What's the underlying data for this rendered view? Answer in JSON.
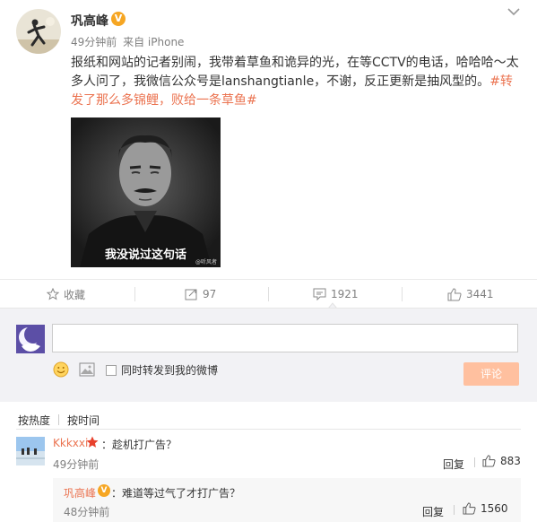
{
  "post": {
    "author": "巩高峰",
    "verified_mark": "V",
    "time": "49分钟前",
    "source": "来自 iPhone",
    "text": "报纸和网站的记者别闹，我带着草鱼和诡异的光，在等CCTV的电话，哈哈哈～太多人问了，我微信公众号是lanshangtianle，不谢，反正更新是抽风型的。",
    "topic": "#转发了那么多锦鲤，败给一条草鱼#",
    "image_caption": "我没说过这句话",
    "image_watermark": "@听风者",
    "accent_color": "#eb7350"
  },
  "actions": {
    "favorite_label": "收藏",
    "repost_count": "97",
    "comment_count": "1921",
    "like_count": "3441"
  },
  "composer": {
    "input_value": "",
    "checkbox_label": "同时转发到我的微博",
    "submit_label": "评论",
    "submit_color": "#ffc09f"
  },
  "sort": {
    "hot_label": "按热度",
    "time_label": "按时间"
  },
  "comments": [
    {
      "name": "Kkkxxi",
      "text": "：趁机打广告？",
      "time": "49分钟前",
      "reply_label": "回复",
      "likes": "883",
      "reply": {
        "name": "巩高峰",
        "badge": "V",
        "text": "：难道等过气了才打广告？",
        "time": "48分钟前",
        "reply_label": "回复",
        "likes": "1560"
      }
    }
  ]
}
